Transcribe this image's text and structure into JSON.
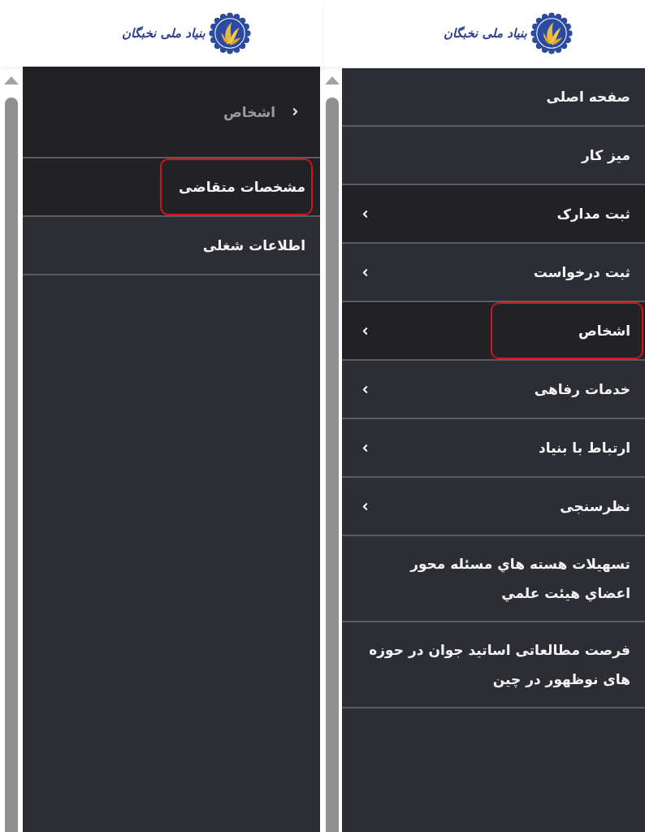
{
  "panels": [
    {
      "logo": {
        "text": "بنیاد ملی نخبگان"
      },
      "menu": {
        "items": [
          {
            "kind": "link",
            "label": "صفحه اصلی",
            "active": false,
            "circled": false
          },
          {
            "kind": "link",
            "label": "میز کار",
            "active": false,
            "circled": false
          },
          {
            "kind": "submenu",
            "label": "ثبت مدارک",
            "active": true,
            "circled": false
          },
          {
            "kind": "submenu",
            "label": "ثبت درخواست",
            "active": false,
            "circled": false
          },
          {
            "kind": "submenu",
            "label": "اشخاص",
            "active": true,
            "circled": true
          },
          {
            "kind": "submenu",
            "label": "خدمات رفاهی",
            "active": false,
            "circled": false
          },
          {
            "kind": "submenu",
            "label": "ارتباط با بنیاد",
            "active": false,
            "circled": false
          },
          {
            "kind": "submenu",
            "label": "نظرسنجی",
            "active": false,
            "circled": false
          },
          {
            "kind": "link",
            "label": "تسهیلات هسته هاي مسئله محور اعضاي هيئت علمي",
            "active": false,
            "circled": false
          },
          {
            "kind": "link",
            "label": "فرصت مطالعاتی اساتید جوان در حوزه های نوظهور در چین",
            "active": false,
            "circled": false
          }
        ]
      }
    },
    {
      "logo": {
        "text": "بنیاد ملی نخبگان"
      },
      "menu": {
        "items": [
          {
            "kind": "back",
            "label": "اشخاص",
            "active": true,
            "circled": false
          },
          {
            "kind": "link",
            "label": "مشخصات متقاضی",
            "active": true,
            "circled": true
          },
          {
            "kind": "link",
            "label": "اطلاعات شغلی",
            "active": false,
            "circled": false
          }
        ]
      }
    }
  ]
}
